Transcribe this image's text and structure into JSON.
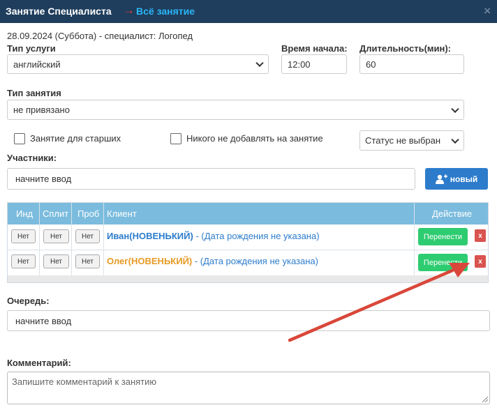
{
  "dialog": {
    "title": "Занятие Специалиста",
    "arrow": "→",
    "subtitle": "Всё занятие",
    "close": "×"
  },
  "info": {
    "header": "28.09.2024 (Суббота) - специалист: Логопед"
  },
  "service_type": {
    "label": "Тип услуги",
    "value": "английский"
  },
  "start_time": {
    "label": "Время начала:",
    "value": "12:00"
  },
  "duration": {
    "label": "Длительность(мин):",
    "value": "60"
  },
  "lesson_type": {
    "label": "Тип занятия",
    "value": "не привязано"
  },
  "options": {
    "senior_label": "Занятие для старших",
    "no_add_label": "Никого не добавлять на занятие",
    "status_value": "Статус не выбран"
  },
  "participants": {
    "label": "Участники:",
    "placeholder": "начните ввод",
    "new_button": "новый"
  },
  "table": {
    "headers": [
      "Инд",
      "Сплит",
      "Проб",
      "Клиент",
      "Действие"
    ],
    "rows": [
      {
        "ind": "Нет",
        "split": "Нет",
        "prob": "Нет",
        "name": "Иван(НОВЕНЬКИЙ)",
        "rest": " - (Дата рождения не указана)",
        "name_color": "#2d7ccc",
        "action": "Перенести",
        "delete": "x"
      },
      {
        "ind": "Нет",
        "split": "Нет",
        "prob": "Нет",
        "name": "Олег(НОВЕНЬКИЙ)",
        "rest": " - (Дата рождения не указана)",
        "name_color": "#e69a24",
        "action": "Перенести",
        "delete": "x"
      }
    ]
  },
  "queue": {
    "label": "Очередь:",
    "placeholder": "начните ввод"
  },
  "comment": {
    "label": "Комментарий:",
    "placeholder": "Запишите комментарий к занятию"
  },
  "colors": {
    "titlebar": "#1f3d5c",
    "accent_blue": "#2d7ccc",
    "table_header": "#7bbcde",
    "success": "#2ecc71",
    "danger": "#d9534f",
    "annotation_arrow": "#d9473a"
  }
}
